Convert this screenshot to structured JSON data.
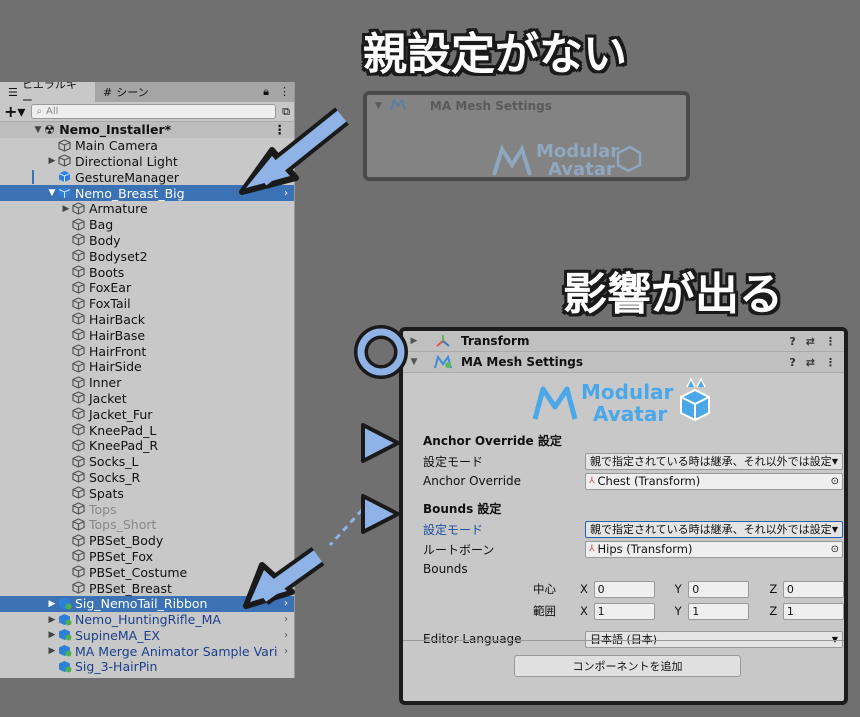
{
  "captions": {
    "no_parent": "親設定がない",
    "affected": "影響が出る"
  },
  "hierarchy": {
    "tab_hierarchy": "ヒエラルキー",
    "tab_scene": "シーン",
    "search_placeholder": "All",
    "scene_name": "Nemo_Installer*",
    "items": [
      {
        "label": "Main Camera",
        "depth": 1,
        "arrow": "",
        "style": "normal",
        "icon": "gameobject-icon"
      },
      {
        "label": "Directional Light",
        "depth": 1,
        "arrow": "▶",
        "style": "normal",
        "icon": "gameobject-icon"
      },
      {
        "label": "GestureManager",
        "depth": 1,
        "arrow": "",
        "style": "normal",
        "icon": "prefab-icon"
      },
      {
        "label": "Nemo_Breast_Big",
        "depth": 1,
        "arrow": "▼",
        "style": "selected",
        "icon": "prefab-icon"
      },
      {
        "label": "Armature",
        "depth": 2,
        "arrow": "▶",
        "style": "normal",
        "icon": "gameobject-icon"
      },
      {
        "label": "Bag",
        "depth": 2,
        "arrow": "",
        "style": "normal",
        "icon": "gameobject-icon"
      },
      {
        "label": "Body",
        "depth": 2,
        "arrow": "",
        "style": "normal",
        "icon": "gameobject-icon"
      },
      {
        "label": "Bodyset2",
        "depth": 2,
        "arrow": "",
        "style": "normal",
        "icon": "gameobject-icon"
      },
      {
        "label": "Boots",
        "depth": 2,
        "arrow": "",
        "style": "normal",
        "icon": "gameobject-icon"
      },
      {
        "label": "FoxEar",
        "depth": 2,
        "arrow": "",
        "style": "normal",
        "icon": "gameobject-icon"
      },
      {
        "label": "FoxTail",
        "depth": 2,
        "arrow": "",
        "style": "normal",
        "icon": "gameobject-icon"
      },
      {
        "label": "HairBack",
        "depth": 2,
        "arrow": "",
        "style": "normal",
        "icon": "gameobject-icon"
      },
      {
        "label": "HairBase",
        "depth": 2,
        "arrow": "",
        "style": "normal",
        "icon": "gameobject-icon"
      },
      {
        "label": "HairFront",
        "depth": 2,
        "arrow": "",
        "style": "normal",
        "icon": "gameobject-icon"
      },
      {
        "label": "HairSide",
        "depth": 2,
        "arrow": "",
        "style": "normal",
        "icon": "gameobject-icon"
      },
      {
        "label": "Inner",
        "depth": 2,
        "arrow": "",
        "style": "normal",
        "icon": "gameobject-icon"
      },
      {
        "label": "Jacket",
        "depth": 2,
        "arrow": "",
        "style": "normal",
        "icon": "gameobject-icon"
      },
      {
        "label": "Jacket_Fur",
        "depth": 2,
        "arrow": "",
        "style": "normal",
        "icon": "gameobject-icon"
      },
      {
        "label": "KneePad_L",
        "depth": 2,
        "arrow": "",
        "style": "normal",
        "icon": "gameobject-icon"
      },
      {
        "label": "KneePad_R",
        "depth": 2,
        "arrow": "",
        "style": "normal",
        "icon": "gameobject-icon"
      },
      {
        "label": "Socks_L",
        "depth": 2,
        "arrow": "",
        "style": "normal",
        "icon": "gameobject-icon"
      },
      {
        "label": "Socks_R",
        "depth": 2,
        "arrow": "",
        "style": "normal",
        "icon": "gameobject-icon"
      },
      {
        "label": "Spats",
        "depth": 2,
        "arrow": "",
        "style": "normal",
        "icon": "gameobject-icon"
      },
      {
        "label": "Tops",
        "depth": 2,
        "arrow": "",
        "style": "dim",
        "icon": "gameobject-icon"
      },
      {
        "label": "Tops_Short",
        "depth": 2,
        "arrow": "",
        "style": "dim",
        "icon": "gameobject-icon"
      },
      {
        "label": "PBSet_Body",
        "depth": 2,
        "arrow": "",
        "style": "normal",
        "icon": "gameobject-icon"
      },
      {
        "label": "PBSet_Fox",
        "depth": 2,
        "arrow": "",
        "style": "normal",
        "icon": "gameobject-icon"
      },
      {
        "label": "PBSet_Costume",
        "depth": 2,
        "arrow": "",
        "style": "normal",
        "icon": "gameobject-icon"
      },
      {
        "label": "PBSet_Breast",
        "depth": 2,
        "arrow": "",
        "style": "normal",
        "icon": "gameobject-icon"
      },
      {
        "label": "Sig_NemoTail_Ribbon",
        "depth": 1,
        "arrow": "▶",
        "style": "selected",
        "icon": "prefab-ma-icon"
      },
      {
        "label": "Nemo_HuntingRifle_MA",
        "depth": 1,
        "arrow": "▶",
        "style": "prefab",
        "icon": "prefab-ma-icon"
      },
      {
        "label": "SupineMA_EX",
        "depth": 1,
        "arrow": "▶",
        "style": "prefab",
        "icon": "prefab-ma-icon"
      },
      {
        "label": "MA Merge Animator Sample Vari",
        "depth": 1,
        "arrow": "▶",
        "style": "prefab",
        "icon": "prefab-ma-icon"
      },
      {
        "label": "Sig_3-HairPin",
        "depth": 1,
        "arrow": "",
        "style": "prefab",
        "icon": "prefab-ma-icon"
      }
    ]
  },
  "ghost": {
    "component_title": "MA Mesh Settings",
    "logo_line1": "Modular",
    "logo_line2": "Avatar"
  },
  "inspector": {
    "transform_title": "Transform",
    "mesh_settings_title": "MA Mesh Settings",
    "logo_line1": "Modular",
    "logo_line2": "Avatar",
    "anchor_section": "Anchor Override 設定",
    "anchor_mode_label": "設定モード",
    "anchor_mode_value": "親で指定されている時は継承、それ以外では設定",
    "anchor_override_label": "Anchor Override",
    "anchor_override_value": "Chest (Transform)",
    "bounds_section": "Bounds 設定",
    "bounds_mode_label": "設定モード",
    "bounds_mode_value": "親で指定されている時は継承、それ以外では設定",
    "root_bone_label": "ルートボーン",
    "root_bone_value": "Hips (Transform)",
    "bounds_label": "Bounds",
    "center_label": "中心",
    "extent_label": "範囲",
    "center": {
      "x": "0",
      "y": "0",
      "z": "0"
    },
    "extent": {
      "x": "1",
      "y": "1",
      "z": "1"
    },
    "axis_x": "X",
    "axis_y": "Y",
    "axis_z": "Z",
    "language_label": "Editor Language",
    "language_value": "日本語 (日本)",
    "add_component": "コンポーネントを追加"
  },
  "colors": {
    "arrow_blue": "#8fb3e6",
    "selection": "#3a72b5",
    "logo_blue": "#4aa8e8"
  }
}
